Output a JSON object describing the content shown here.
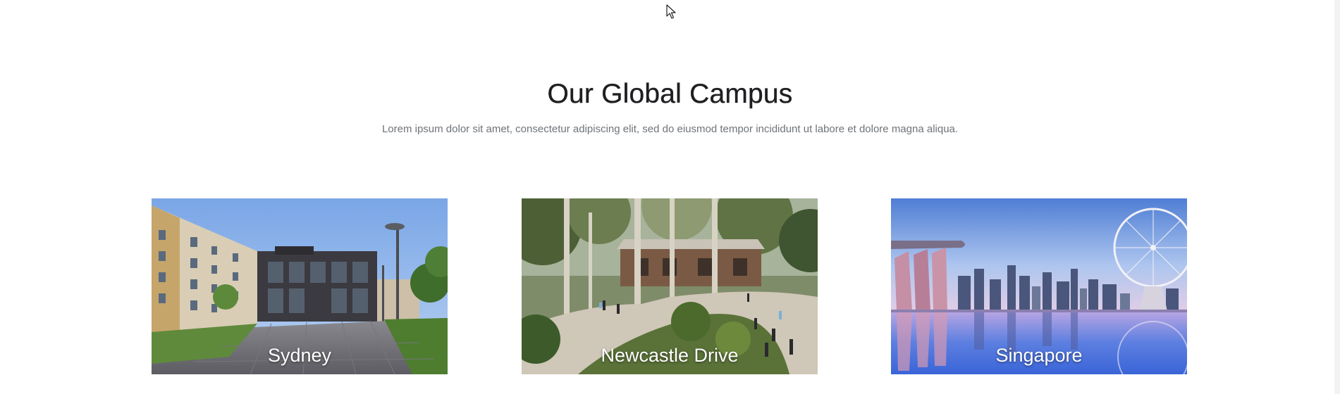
{
  "section": {
    "title": "Our Global Campus",
    "subtitle": "Lorem ipsum dolor sit amet, consectetur adipiscing elit, sed do eiusmod tempor incididunt ut labore et dolore magna aliqua."
  },
  "campuses": [
    {
      "name": "Sydney",
      "image": "modern campus buildings with paved courtyard and lamp posts"
    },
    {
      "name": "Newcastle Drive",
      "image": "bushland campus walkway with trees and students"
    },
    {
      "name": "Singapore",
      "image": "Marina Bay skyline with Singapore Flyer reflected in water"
    }
  ],
  "colors": {
    "title": "#1f1f22",
    "subtitle": "#6f7378",
    "caption": "#ffffff",
    "background": "#ffffff"
  },
  "icons": {
    "cursor": "mouse-pointer-icon"
  }
}
